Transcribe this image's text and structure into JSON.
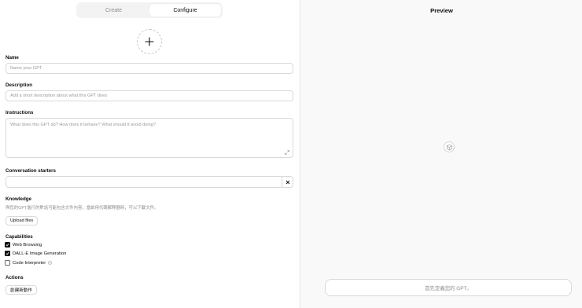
{
  "tabs": {
    "create": "Create",
    "configure": "Configure"
  },
  "form": {
    "name_label": "Name",
    "name_placeholder": "Name your GPT",
    "description_label": "Description",
    "description_placeholder": "Add a short description about what this GPT does",
    "instructions_label": "Instructions",
    "instructions_placeholder": "What does this GPT do? How does it behave? What should it avoid doing?",
    "starters_label": "Conversation starters",
    "starters_value": "",
    "knowledge_label": "Knowledge",
    "knowledge_hint": "與您的GPT進行的對話可能包含文件內容。當啟用代碼解釋器時，可以下載文件。",
    "upload_label": "Upload files",
    "capabilities_label": "Capabilities",
    "capabilities": [
      {
        "label": "Web Browsing",
        "checked": true
      },
      {
        "label": "DALL·E Image Generation",
        "checked": true
      },
      {
        "label": "Code Interpreter",
        "checked": false
      }
    ],
    "actions_label": "Actions",
    "create_action_label": "創建新動作"
  },
  "preview": {
    "title": "Preview",
    "placeholder": "首先定義您的 GPT。"
  },
  "icons": {
    "add": "plus-icon",
    "clear": "close-icon",
    "expand": "expand-icon",
    "check": "check-icon",
    "help": "help-icon",
    "cube": "cube-icon"
  },
  "colors": {
    "accent": "#0d0d0d",
    "border": "#d9d9d9",
    "muted": "#8e8e8e",
    "preview_bg": "#f9f9f9"
  }
}
